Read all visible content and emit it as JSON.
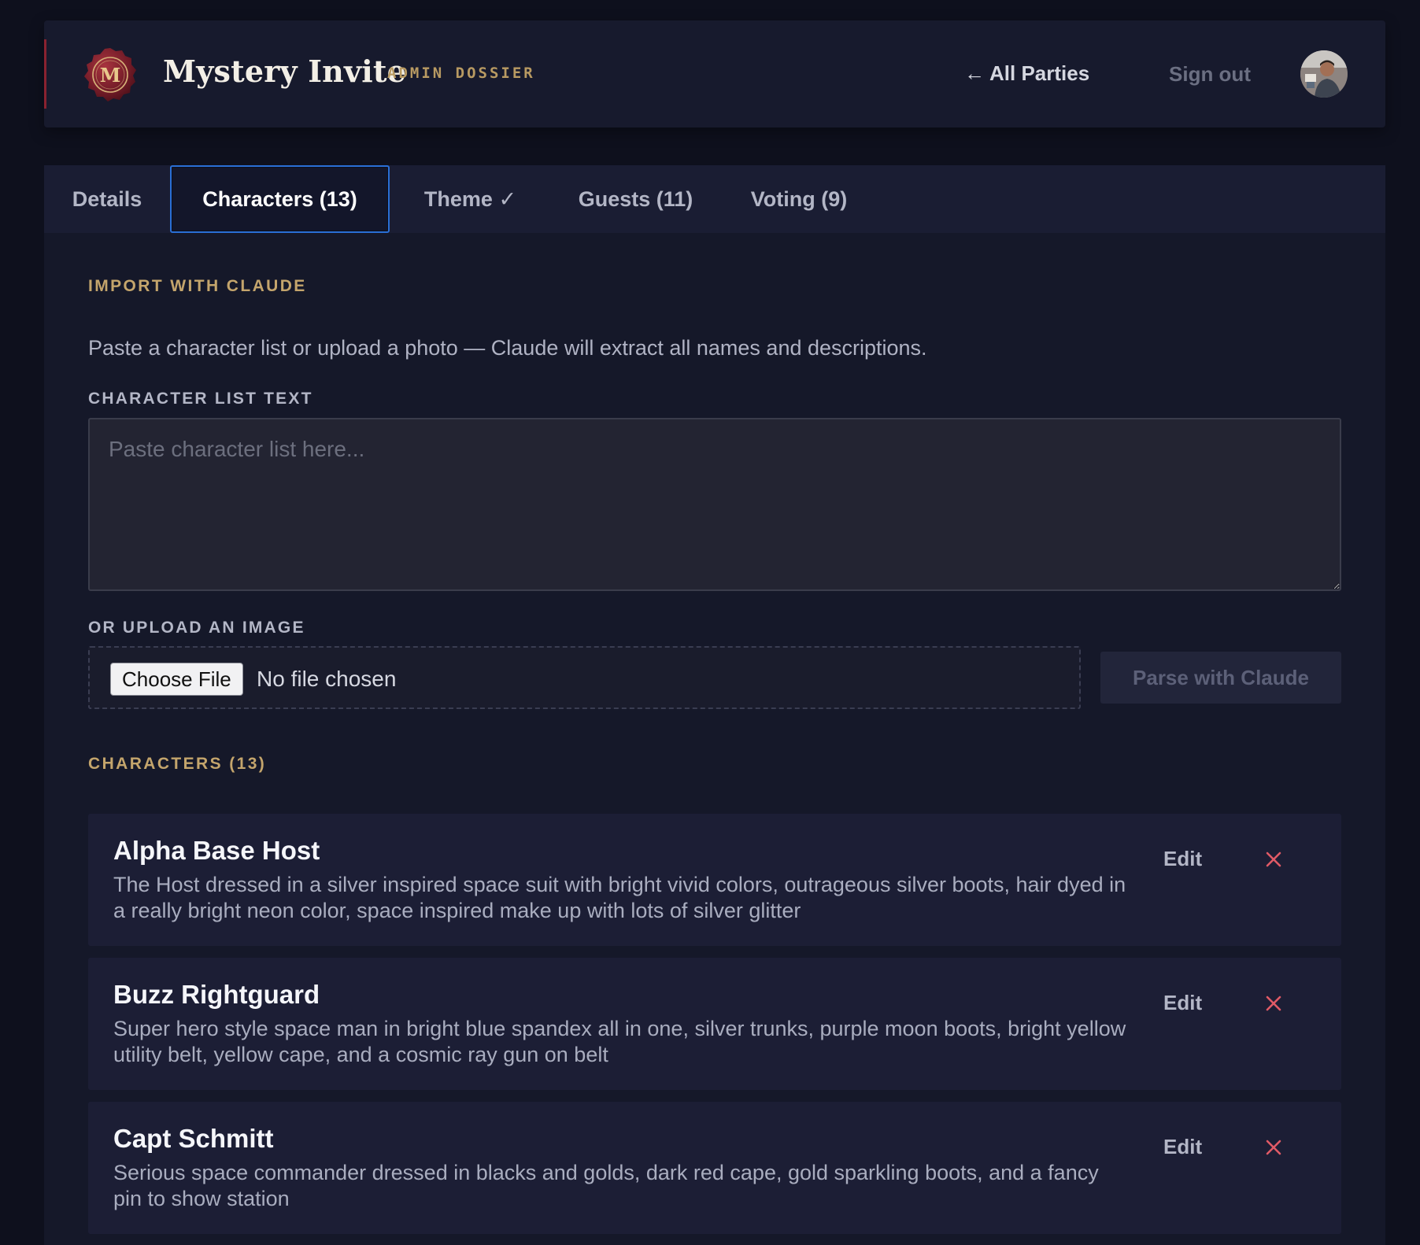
{
  "header": {
    "brand_title": "Mystery Invite",
    "brand_subtitle": "ADMIN DOSSIER",
    "seal_monogram": "M",
    "back_link": "All Parties",
    "sign_out": "Sign out",
    "accent_color": "#8a2230",
    "gold_color": "#c4a56c"
  },
  "tabs": [
    {
      "label": "Details",
      "active": false
    },
    {
      "label": "Characters (13)",
      "active": true
    },
    {
      "label": "Theme ✓",
      "active": false
    },
    {
      "label": "Guests (11)",
      "active": false
    },
    {
      "label": "Voting (9)",
      "active": false
    }
  ],
  "import": {
    "section_title": "IMPORT WITH CLAUDE",
    "helper_text": "Paste a character list or upload a photo — Claude will extract all names and descriptions.",
    "text_label": "CHARACTER LIST TEXT",
    "text_placeholder": "Paste character list here...",
    "text_value": "",
    "upload_label": "OR UPLOAD AN IMAGE",
    "file_button": "Choose File",
    "file_status": "No file chosen",
    "parse_button": "Parse with Claude"
  },
  "characters": {
    "section_title": "CHARACTERS (13)",
    "edit_label": "Edit",
    "items": [
      {
        "name": "Alpha Base Host",
        "description": "The Host dressed in a silver inspired space suit with bright vivid colors, outrageous silver boots, hair dyed in a really bright neon color, space inspired make up with lots of silver glitter"
      },
      {
        "name": "Buzz Rightguard",
        "description": "Super hero style space man in bright blue spandex all in one, silver trunks, purple moon boots, bright yellow utility belt, yellow cape, and a cosmic ray gun on belt"
      },
      {
        "name": "Capt Schmitt",
        "description": "Serious space commander dressed in blacks and golds, dark red cape, gold sparkling boots, and a fancy pin to show station"
      }
    ]
  }
}
